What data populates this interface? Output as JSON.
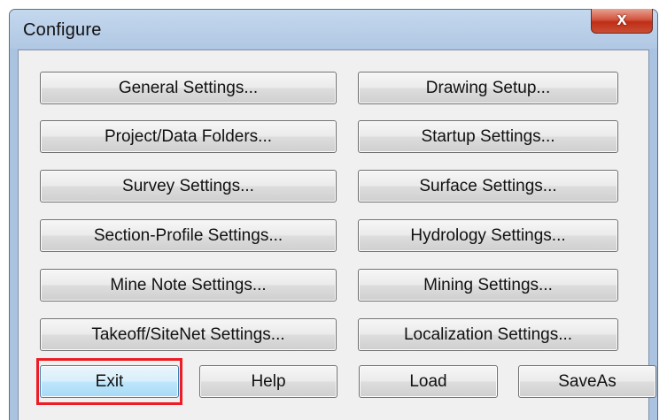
{
  "window": {
    "title": "Configure",
    "close_glyph": "x"
  },
  "settings_buttons": [
    {
      "label": "General Settings..."
    },
    {
      "label": "Drawing Setup..."
    },
    {
      "label": "Project/Data Folders..."
    },
    {
      "label": "Startup Settings..."
    },
    {
      "label": "Survey Settings..."
    },
    {
      "label": "Surface Settings..."
    },
    {
      "label": "Section-Profile Settings..."
    },
    {
      "label": "Hydrology Settings..."
    },
    {
      "label": "Mine Note Settings..."
    },
    {
      "label": "Mining Settings..."
    },
    {
      "label": "Takeoff/SiteNet Settings..."
    },
    {
      "label": "Localization Settings..."
    }
  ],
  "footer_buttons": {
    "exit": "Exit",
    "help": "Help",
    "load": "Load",
    "saveas": "SaveAs"
  },
  "colors": {
    "highlight": "#ee1c25",
    "close_button": "#c9452c"
  }
}
